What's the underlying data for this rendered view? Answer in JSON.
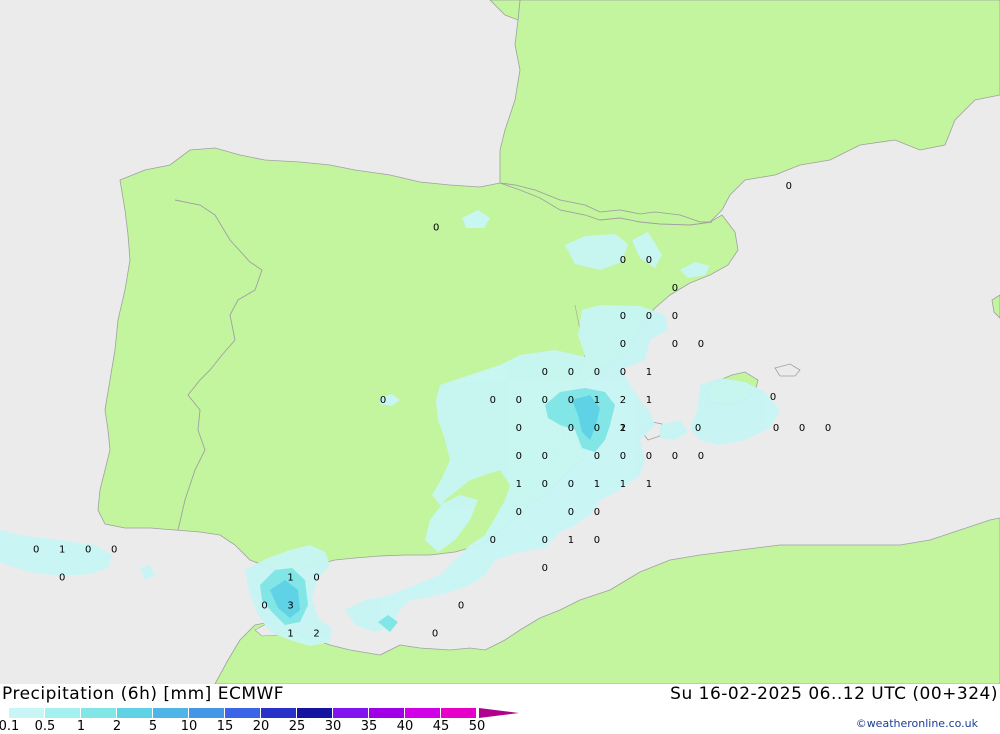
{
  "title": "Precipitation (6h) [mm] ECMWF",
  "datetime": "Su 16-02-2025 06..12 UTC (00+324)",
  "credit": "©weatheronline.co.uk",
  "colors": {
    "sea": "#ebebeb",
    "land": "#c2f59e",
    "border": "#a0a0a0"
  },
  "legend": {
    "ticks": [
      "0.1",
      "0.5",
      "1",
      "2",
      "5",
      "10",
      "15",
      "20",
      "25",
      "30",
      "35",
      "40",
      "45",
      "50"
    ],
    "colors": [
      "#c8f5f5",
      "#a5f0f0",
      "#82e6e6",
      "#5fd2e6",
      "#50b4e6",
      "#4696e6",
      "#3c64e6",
      "#2832c8",
      "#1414a0",
      "#8214f0",
      "#a000e6",
      "#d200e6",
      "#e600c8",
      "#b0008c"
    ]
  },
  "precip_values": [
    {
      "lat": 43.27,
      "lon": 2.9,
      "value": "0"
    },
    {
      "lat": 42.6,
      "lon": -3.2,
      "value": "0"
    },
    {
      "lat": 42.08,
      "lon": 0.03,
      "value": "0"
    },
    {
      "lat": 42.08,
      "lon": 0.48,
      "value": "0"
    },
    {
      "lat": 41.63,
      "lon": 0.93,
      "value": "0"
    },
    {
      "lat": 41.18,
      "lon": 0.03,
      "value": "0"
    },
    {
      "lat": 41.18,
      "lon": 0.48,
      "value": "0"
    },
    {
      "lat": 41.18,
      "lon": 0.93,
      "value": "0"
    },
    {
      "lat": 40.73,
      "lon": 0.03,
      "value": "0"
    },
    {
      "lat": 40.73,
      "lon": 0.93,
      "value": "0"
    },
    {
      "lat": 40.73,
      "lon": 1.38,
      "value": "0"
    },
    {
      "lat": 40.28,
      "lon": -1.32,
      "value": "0"
    },
    {
      "lat": 40.28,
      "lon": -0.87,
      "value": "0"
    },
    {
      "lat": 40.28,
      "lon": -0.42,
      "value": "0"
    },
    {
      "lat": 40.28,
      "lon": 0.03,
      "value": "0"
    },
    {
      "lat": 40.28,
      "lon": 0.48,
      "value": "1"
    },
    {
      "lat": 39.83,
      "lon": -4.12,
      "value": "0"
    },
    {
      "lat": 39.83,
      "lon": -2.22,
      "value": "0"
    },
    {
      "lat": 39.83,
      "lon": -1.77,
      "value": "0"
    },
    {
      "lat": 39.83,
      "lon": -1.32,
      "value": "0"
    },
    {
      "lat": 39.83,
      "lon": -0.87,
      "value": "0"
    },
    {
      "lat": 39.83,
      "lon": -0.42,
      "value": "1"
    },
    {
      "lat": 39.83,
      "lon": 0.03,
      "value": "2"
    },
    {
      "lat": 39.83,
      "lon": 0.48,
      "value": "1"
    },
    {
      "lat": 39.88,
      "lon": 2.63,
      "value": "0"
    },
    {
      "lat": 39.38,
      "lon": -1.77,
      "value": "0"
    },
    {
      "lat": 39.38,
      "lon": -0.87,
      "value": "0"
    },
    {
      "lat": 39.38,
      "lon": -0.42,
      "value": "0"
    },
    {
      "lat": 39.38,
      "lon": 0.03,
      "value": "1"
    },
    {
      "lat": 39.38,
      "lon": 0.03,
      "value": "2"
    },
    {
      "lat": 39.38,
      "lon": 1.33,
      "value": "0"
    },
    {
      "lat": 39.38,
      "lon": 2.68,
      "value": "0"
    },
    {
      "lat": 39.38,
      "lon": 3.13,
      "value": "0"
    },
    {
      "lat": 39.38,
      "lon": 3.58,
      "value": "0"
    },
    {
      "lat": 38.93,
      "lon": -1.77,
      "value": "0"
    },
    {
      "lat": 38.93,
      "lon": -1.32,
      "value": "0"
    },
    {
      "lat": 38.93,
      "lon": -0.42,
      "value": "0"
    },
    {
      "lat": 38.93,
      "lon": 0.03,
      "value": "0"
    },
    {
      "lat": 38.93,
      "lon": 0.48,
      "value": "0"
    },
    {
      "lat": 38.93,
      "lon": 0.93,
      "value": "0"
    },
    {
      "lat": 38.93,
      "lon": 1.38,
      "value": "0"
    },
    {
      "lat": 38.78,
      "lon": 8.93,
      "value": "0"
    },
    {
      "lat": 38.48,
      "lon": -1.77,
      "value": "1"
    },
    {
      "lat": 38.48,
      "lon": -1.32,
      "value": "0"
    },
    {
      "lat": 38.48,
      "lon": -0.87,
      "value": "0"
    },
    {
      "lat": 38.48,
      "lon": -0.42,
      "value": "1"
    },
    {
      "lat": 38.48,
      "lon": 0.03,
      "value": "1"
    },
    {
      "lat": 38.48,
      "lon": 0.48,
      "value": "1"
    },
    {
      "lat": 38.03,
      "lon": -1.77,
      "value": "0"
    },
    {
      "lat": 38.03,
      "lon": -0.87,
      "value": "0"
    },
    {
      "lat": 38.03,
      "lon": -0.42,
      "value": "0"
    },
    {
      "lat": 37.58,
      "lon": -2.22,
      "value": "0"
    },
    {
      "lat": 37.58,
      "lon": -1.32,
      "value": "0"
    },
    {
      "lat": 37.58,
      "lon": -0.87,
      "value": "1"
    },
    {
      "lat": 37.58,
      "lon": -0.42,
      "value": "0"
    },
    {
      "lat": 37.13,
      "lon": -1.32,
      "value": "0"
    },
    {
      "lat": 37.43,
      "lon": -10.12,
      "value": "0"
    },
    {
      "lat": 37.43,
      "lon": -9.67,
      "value": "1"
    },
    {
      "lat": 37.43,
      "lon": -9.22,
      "value": "0"
    },
    {
      "lat": 37.43,
      "lon": -8.77,
      "value": "0"
    },
    {
      "lat": 36.98,
      "lon": -9.67,
      "value": "0"
    },
    {
      "lat": 36.98,
      "lon": -5.72,
      "value": "1"
    },
    {
      "lat": 36.98,
      "lon": -5.27,
      "value": "0"
    },
    {
      "lat": 36.53,
      "lon": -6.17,
      "value": "0"
    },
    {
      "lat": 36.53,
      "lon": -5.72,
      "value": "3"
    },
    {
      "lat": 36.53,
      "lon": -2.77,
      "value": "0"
    },
    {
      "lat": 36.08,
      "lon": -5.72,
      "value": "1"
    },
    {
      "lat": 36.08,
      "lon": -5.27,
      "value": "2"
    },
    {
      "lat": 36.08,
      "lon": -3.22,
      "value": "0"
    }
  ]
}
